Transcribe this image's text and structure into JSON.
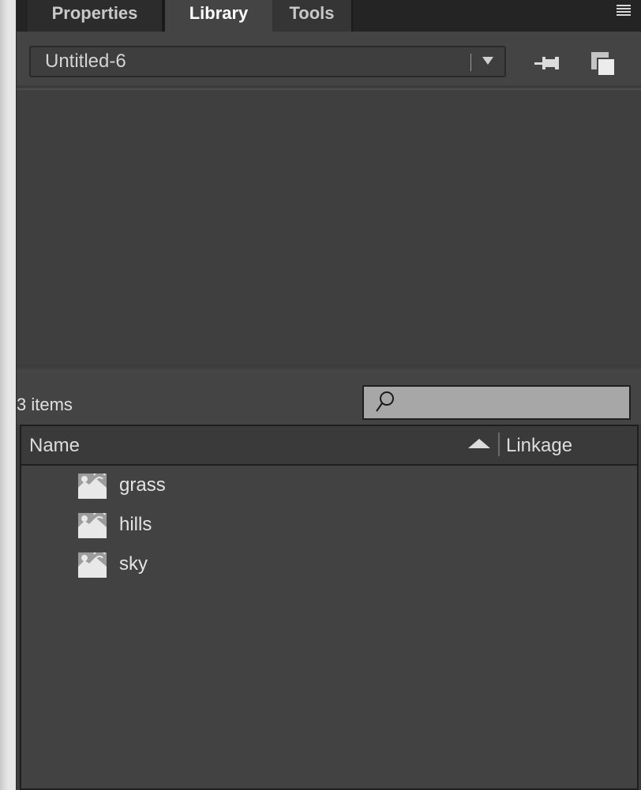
{
  "tabs": [
    {
      "label": "Properties",
      "active": false
    },
    {
      "label": "Library",
      "active": true
    },
    {
      "label": "Tools",
      "active": false
    }
  ],
  "panel_menu_icon": "hamburger-menu-icon",
  "document_select": {
    "value": "Untitled-6"
  },
  "icons": {
    "pin": "pin-icon",
    "new_library_panel": "new-library-panel-icon",
    "search": "search-icon",
    "item": "movie-clip-symbol-icon"
  },
  "items_count": "3 items",
  "search": {
    "value": "",
    "placeholder": ""
  },
  "list": {
    "columns": [
      {
        "label": "Name"
      },
      {
        "label": "Linkage"
      }
    ],
    "sort": "ascending",
    "items": [
      {
        "name": "grass"
      },
      {
        "name": "hills"
      },
      {
        "name": "sky"
      }
    ]
  },
  "colors": {
    "panel_bg": "#3c3c3c",
    "tab_active_bg": "#444444",
    "search_bg": "#a7a7a7",
    "text": "#e0e0e0"
  }
}
